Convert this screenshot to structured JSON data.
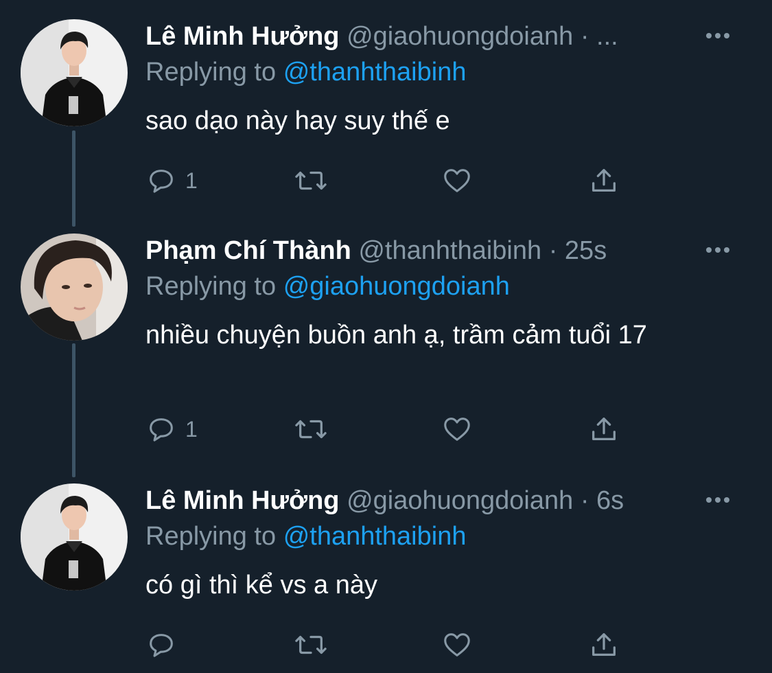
{
  "tweets": [
    {
      "display_name": "Lê Minh Hưởng",
      "handle": "@giaohuongdoianh",
      "separator": "·",
      "time": "...",
      "replying_prefix": "Replying to",
      "replying_to": "@thanhthaibinh",
      "text": "sao dạo này hay suy thế e",
      "reply_count": "1",
      "retweet_count": "",
      "like_count": ""
    },
    {
      "display_name": "Phạm Chí Thành",
      "handle": "@thanhthaibinh",
      "separator": "·",
      "time": "25s",
      "replying_prefix": "Replying to",
      "replying_to": "@giaohuongdoianh",
      "text": "nhiều chuyện buồn anh ạ, trầm cảm tuổi 17",
      "reply_count": "1",
      "retweet_count": "",
      "like_count": ""
    },
    {
      "display_name": "Lê Minh Hưởng",
      "handle": "@giaohuongdoianh",
      "separator": "·",
      "time": "6s",
      "replying_prefix": "Replying to",
      "replying_to": "@thanhthaibinh",
      "text": "có gì thì kể vs a này",
      "reply_count": "",
      "retweet_count": "",
      "like_count": ""
    }
  ],
  "icons": {
    "reply": "reply-icon",
    "retweet": "retweet-icon",
    "like": "heart-icon",
    "share": "share-icon",
    "more": "more-icon"
  },
  "colors": {
    "background": "#15202b",
    "secondary_text": "#8899a6",
    "link": "#1da1f2",
    "thread_line": "#3d5466"
  }
}
